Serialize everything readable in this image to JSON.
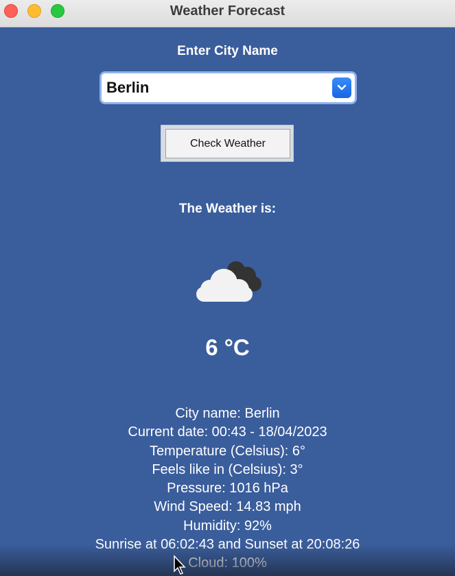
{
  "window": {
    "title": "Weather Forecast"
  },
  "form": {
    "city_label": "Enter City Name",
    "city_value": "Berlin",
    "check_button": "Check Weather"
  },
  "result": {
    "heading": "The Weather is:",
    "icon": "partly-cloudy-icon",
    "temperature": "6 °C",
    "details": [
      "City name: Berlin",
      "Current date: 00:43 - 18/04/2023",
      "Temperature (Celsius): 6°",
      "Feels like in (Celsius): 3°",
      "Pressure: 1016 hPa",
      "Wind Speed: 14.83 mph",
      "Humidity: 92%",
      "Sunrise at 06:02:43 and Sunset at 20:08:26",
      "Cloud: 100%"
    ]
  },
  "colors": {
    "background": "#3a5d9c",
    "accent": "#1666e6"
  }
}
